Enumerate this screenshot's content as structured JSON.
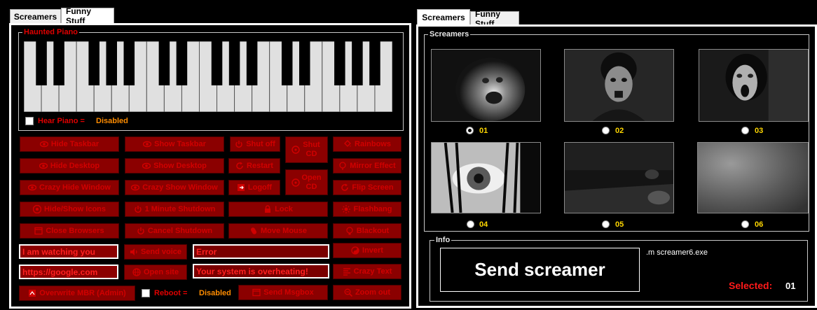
{
  "left": {
    "tabs": [
      {
        "label": "Screamers"
      },
      {
        "label": "Funny Stuff"
      }
    ],
    "piano": {
      "legend": "Haunted Piano",
      "hear_label": "Hear Piano =",
      "hear_status": "Disabled",
      "white_key_count": 21
    },
    "buttons": {
      "hide_taskbar": "Hide Taskbar",
      "show_taskbar": "Show Taskbar",
      "shut_off": "Shut off",
      "shut_cd": "Shut CD",
      "rainbows": "Rainbows",
      "hide_desktop": "Hide Desktop",
      "show_desktop": "Show Desktop",
      "restart": "Restart",
      "mirror_effect": "Mirror Effect",
      "crazy_hide_window": "Crazy Hide Window",
      "crazy_show_window": "Crazy Show Window",
      "logoff": "Logoff",
      "open_cd": "Open CD",
      "flip_screen": "Flip Screen",
      "hide_show_icons": "Hide/Show Icons",
      "one_minute_shutdown": "1 Minute Shutdown",
      "lock": "Lock",
      "flashbang": "Flashbang",
      "close_browsers": "Close Browsers",
      "cancel_shutdown": "Cancel Shutdown",
      "move_mouse": "Move Mouse",
      "blackout": "Blackout",
      "send_voice": "Send voice",
      "invert": "Invert",
      "open_site": "Open site",
      "crazy_text": "Crazy Text",
      "overwrite_mbr": "Overwrite MBR (Admin)",
      "send_msgbox": "Send Msgbox",
      "zoom_out": "Zoom out"
    },
    "inputs": {
      "voice_text": "I am watching you",
      "site_url": "https://google.com",
      "msg_title": "Error",
      "msg_body": "Your system is overheating!"
    },
    "reboot": {
      "label": "Reboot =",
      "status": "Disabled"
    }
  },
  "right": {
    "tabs": [
      {
        "label": "Screamers"
      },
      {
        "label": "Funny Stuff"
      }
    ],
    "group_legend": "Screamers",
    "screamers": [
      {
        "label": "01",
        "selected": true
      },
      {
        "label": "02",
        "selected": false
      },
      {
        "label": "03",
        "selected": false
      },
      {
        "label": "04",
        "selected": false
      },
      {
        "label": "05",
        "selected": false
      },
      {
        "label": "06",
        "selected": false
      }
    ],
    "info": {
      "legend": "Info",
      "send_label": "Send screamer",
      "command": ".m screamer6.exe",
      "selected_label": "Selected:",
      "selected_value": "01"
    }
  },
  "colors": {
    "button_bg": "#8b0000",
    "button_text": "#d00000",
    "status_orange": "#ff8c00",
    "radio_label": "#ffd700"
  }
}
